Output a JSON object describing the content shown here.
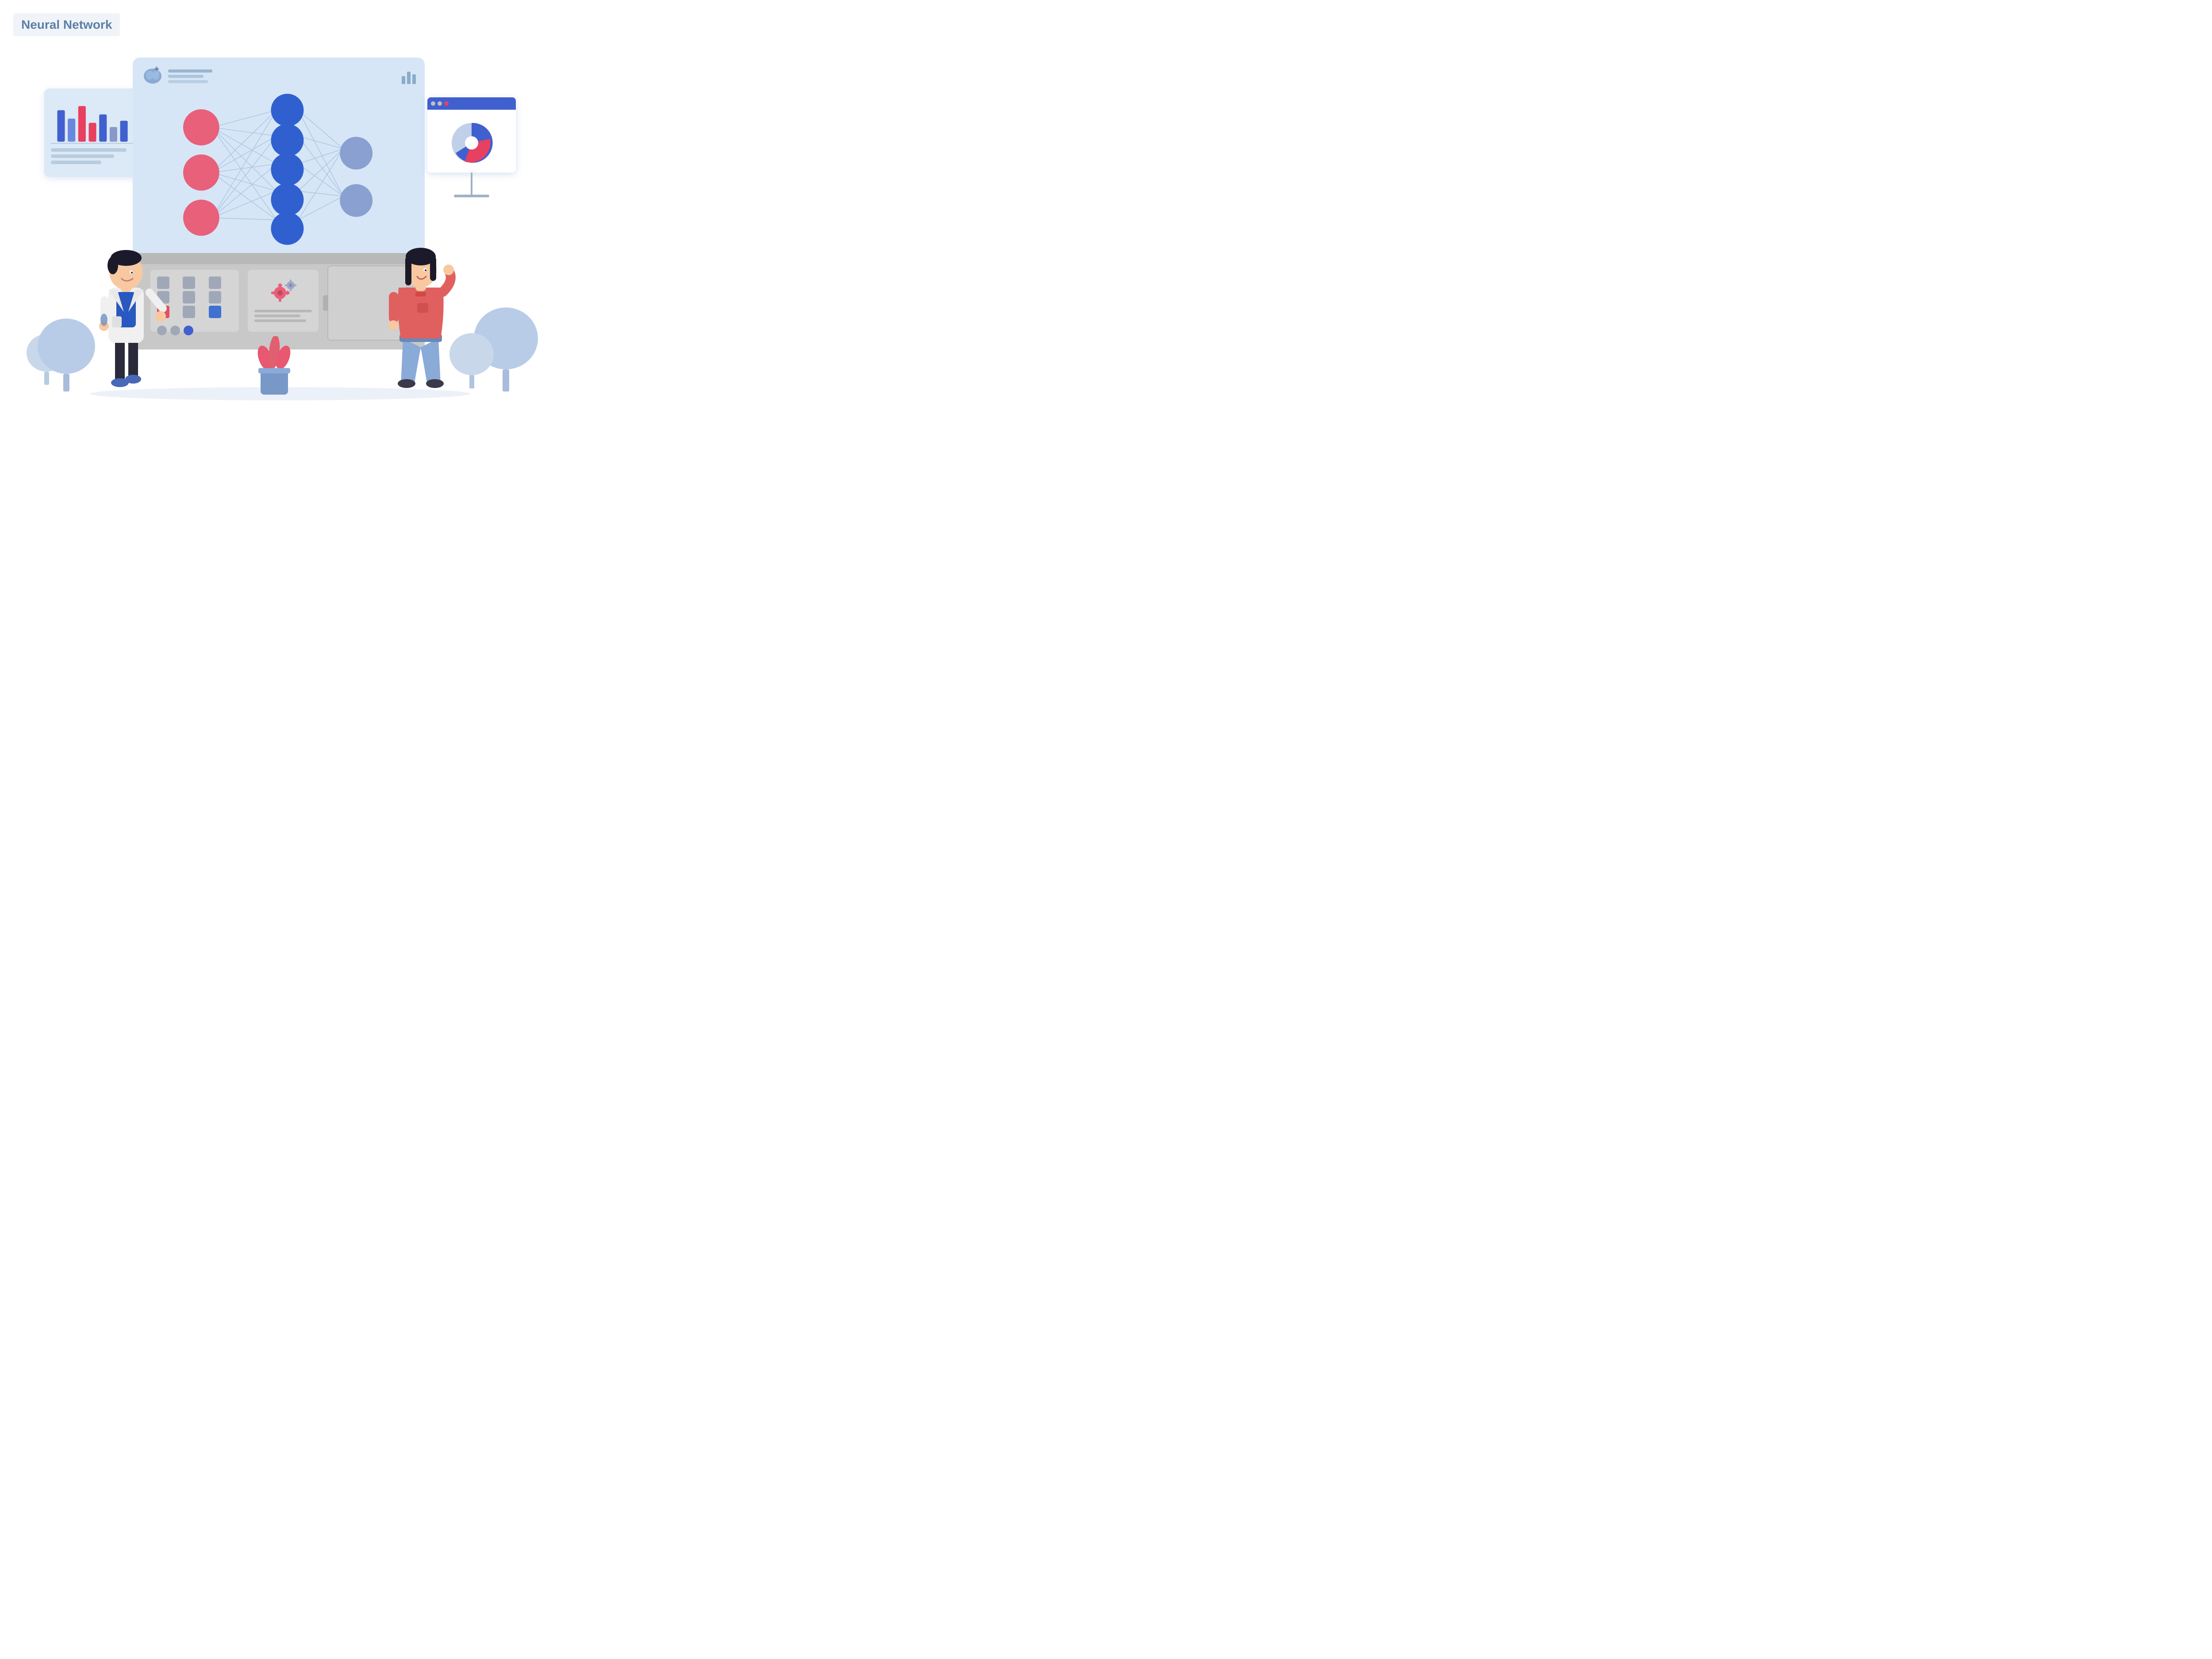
{
  "title": "Neural Network",
  "colors": {
    "accent_blue": "#4060d0",
    "node_pink": "#e8607a",
    "node_blue": "#3060d0",
    "node_output": "#9ab0d8",
    "background": "#ffffff",
    "screen_bg": "#d6e6f7",
    "board_bg": "#dce9f7"
  },
  "network": {
    "input_nodes": 3,
    "hidden_nodes": 5,
    "output_nodes": 2
  }
}
